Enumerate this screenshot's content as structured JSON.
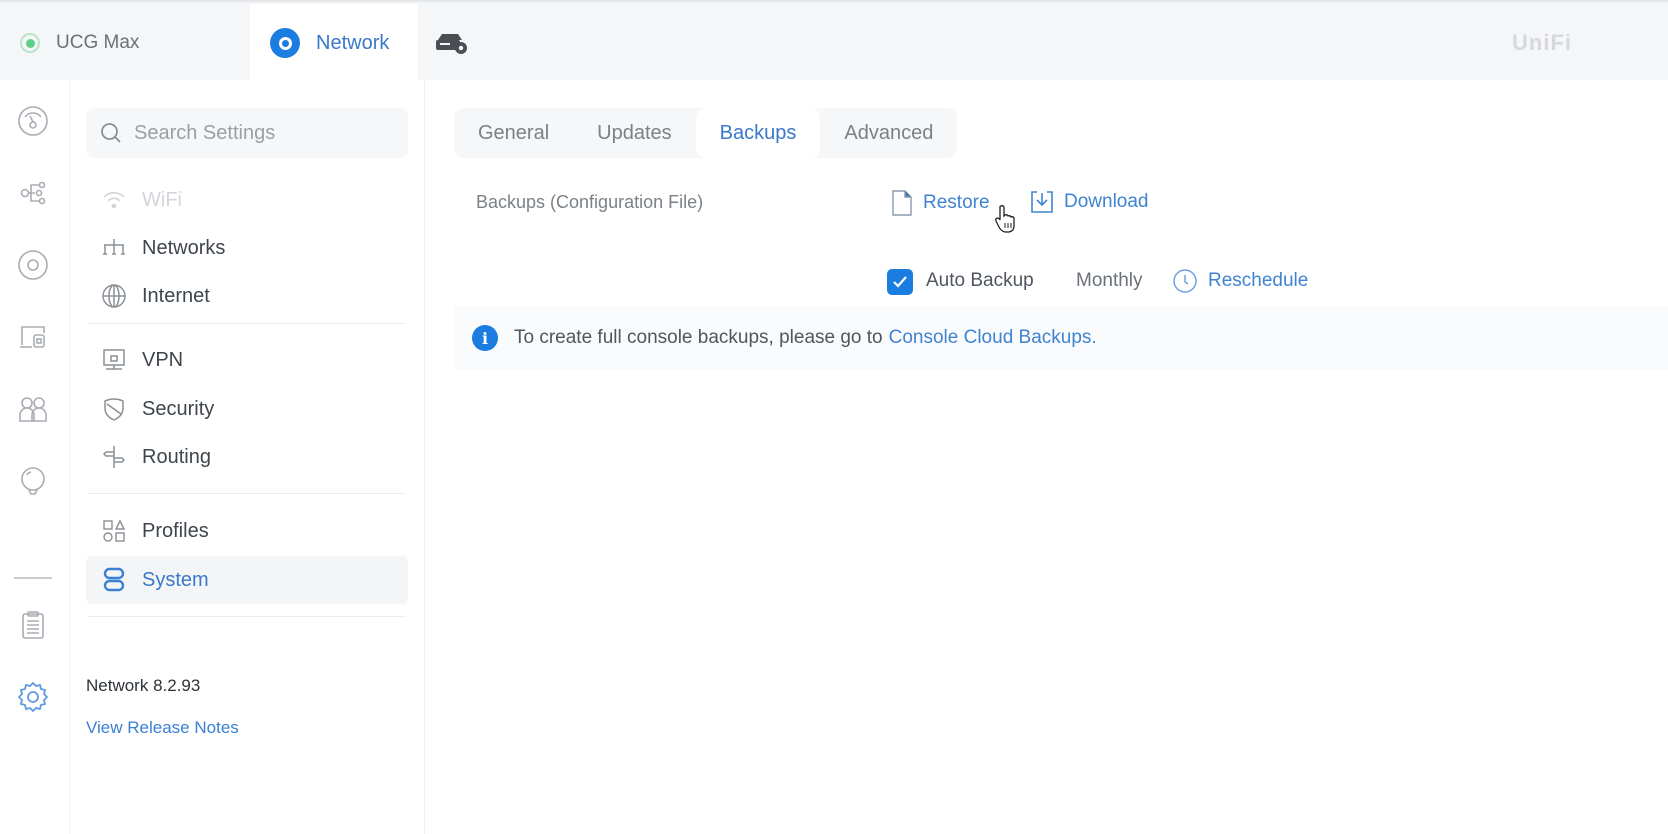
{
  "topbar": {
    "apps": [
      {
        "label": "UCG Max",
        "icon": "device-status-icon",
        "active": false
      },
      {
        "label": "Network",
        "icon": "network-app-icon",
        "active": true
      }
    ],
    "tool_icon": "device-settings-icon",
    "brand": "UniFi"
  },
  "rail": {
    "items": [
      {
        "name": "dashboard",
        "icon": "dashboard-icon"
      },
      {
        "name": "topology",
        "icon": "topology-icon"
      },
      {
        "name": "devices",
        "icon": "devices-icon"
      },
      {
        "name": "client-devices",
        "icon": "client-devices-icon"
      },
      {
        "name": "clients",
        "icon": "clients-icon"
      },
      {
        "name": "insights",
        "icon": "insights-icon"
      },
      {
        "name": "logs",
        "icon": "logs-icon"
      },
      {
        "name": "settings",
        "icon": "settings-icon",
        "active": true
      }
    ]
  },
  "sidebar": {
    "search_placeholder": "Search Settings",
    "items": [
      {
        "label": "WiFi",
        "icon": "wifi-icon",
        "disabled": true
      },
      {
        "label": "Networks",
        "icon": "networks-icon"
      },
      {
        "label": "Internet",
        "icon": "globe-icon"
      },
      {
        "label": "VPN",
        "icon": "vpn-icon"
      },
      {
        "label": "Security",
        "icon": "shield-icon"
      },
      {
        "label": "Routing",
        "icon": "routing-icon"
      },
      {
        "label": "Profiles",
        "icon": "profiles-icon"
      },
      {
        "label": "System",
        "icon": "system-icon",
        "active": true
      }
    ],
    "version": "Network 8.2.93",
    "release_notes": "View Release Notes"
  },
  "main": {
    "tabs": [
      {
        "label": "General",
        "active": false
      },
      {
        "label": "Updates",
        "active": false
      },
      {
        "label": "Backups",
        "active": true
      },
      {
        "label": "Advanced",
        "active": false
      }
    ],
    "backups": {
      "label": "Backups (Configuration File)",
      "restore": "Restore",
      "download": "Download",
      "auto_backup_label": "Auto Backup",
      "auto_backup_checked": true,
      "frequency": "Monthly",
      "reschedule": "Reschedule"
    },
    "banner": {
      "text": "To create full console backups, please go to",
      "link": "Console Cloud Backups."
    }
  },
  "colors": {
    "accent": "#1b7de0",
    "link": "#3f83d2",
    "status_green": "#5fd08b"
  }
}
